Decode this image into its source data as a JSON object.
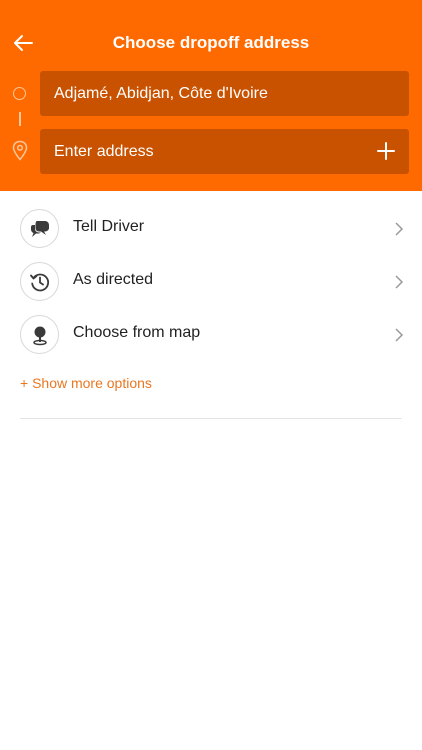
{
  "header": {
    "title": "Choose dropoff address",
    "back_icon": "arrow-left-icon"
  },
  "route": {
    "origin_value": "Adjamé, Abidjan, Côte d'Ivoire",
    "destination_placeholder": "Enter address",
    "add_icon": "plus-icon"
  },
  "options": [
    {
      "label": "Tell Driver",
      "icon": "chat-bubbles-icon"
    },
    {
      "label": "As directed",
      "icon": "clock-history-icon"
    },
    {
      "label": "Choose from map",
      "icon": "map-pin-icon"
    }
  ],
  "more_options": "+ Show more options",
  "colors": {
    "brand": "#ff6a00",
    "field_bg": "#c85200",
    "link": "#e87722"
  }
}
